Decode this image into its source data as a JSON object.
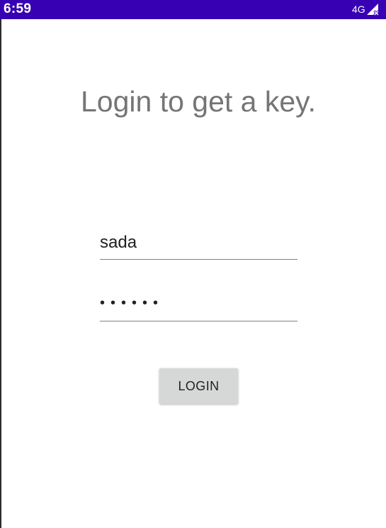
{
  "status_bar": {
    "time": "6:59",
    "network_type": "4G",
    "signal_icon": "signal-no-data-icon",
    "background_color": "#3700b3"
  },
  "login_screen": {
    "title": "Login to get a key.",
    "username_value": "sada",
    "password_masked": "••••••",
    "login_button_label": "LOGIN"
  }
}
